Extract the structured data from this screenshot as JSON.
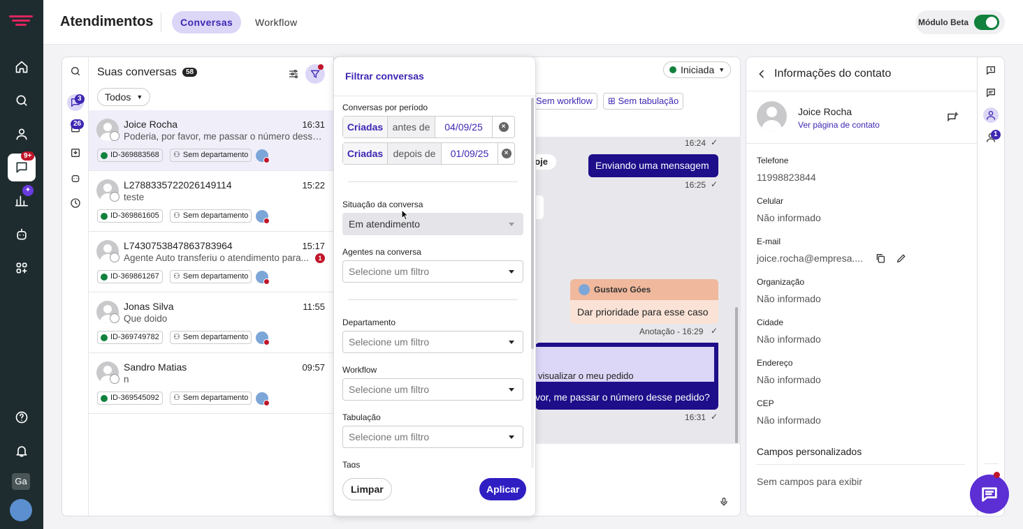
{
  "topbar": {
    "title": "Atendimentos",
    "tabs": [
      "Conversas",
      "Workflow"
    ],
    "beta_label": "Módulo Beta"
  },
  "rail": {
    "chat_badge": "9+",
    "user_initials": "Ga"
  },
  "conversations": {
    "title": "Suas conversas",
    "count": "58",
    "filter_value": "Todos",
    "rail_badges": [
      "3",
      "26"
    ],
    "items": [
      {
        "name": "Joice Rocha",
        "time": "16:31",
        "message": "Poderia, por favor, me passar o número desse pedido?",
        "id": "ID-369883568",
        "department": "Sem departamento",
        "unread": ""
      },
      {
        "name": "L2788335722026149114",
        "time": "15:22",
        "message": "teste",
        "id": "ID-369861605",
        "department": "Sem departamento",
        "unread": ""
      },
      {
        "name": "L7430753847863783964",
        "time": "15:17",
        "message": "Agente Auto transferiu o atendimento para...",
        "id": "ID-369861267",
        "department": "Sem departamento",
        "unread": "1"
      },
      {
        "name": "Jonas Silva",
        "time": "11:55",
        "message": "Que doido",
        "id": "ID-369749782",
        "department": "Sem departamento",
        "unread": ""
      },
      {
        "name": "Sandro Matias",
        "time": "09:57",
        "message": "n",
        "id": "ID-369545092",
        "department": "Sem departamento",
        "unread": ""
      }
    ]
  },
  "chat": {
    "status": "Iniciada",
    "chips": [
      "Sem workflow",
      "Sem tabulação"
    ],
    "day_label": "oje",
    "messages": [
      {
        "time": "16:24"
      },
      {
        "text": "Enviando uma mensagem",
        "time": "16:25"
      },
      {
        "note_author": "Gustavo Góes",
        "text": "Dar prioridade para esse caso",
        "time": "Anotação - 16:29"
      },
      {
        "quote": "visualizar o meu pedido",
        "text": "vor, me passar o número desse pedido?",
        "time": "16:31"
      }
    ]
  },
  "filter": {
    "title": "Filtrar conversas",
    "period_label": "Conversas por período",
    "period_rows": [
      {
        "field": "Criadas",
        "op": "antes de",
        "date": "04/09/25"
      },
      {
        "field": "Criadas",
        "op": "depois de",
        "date": "01/09/25"
      }
    ],
    "status_label": "Situação da conversa",
    "status_value": "Em atendimento",
    "agents_label": "Agentes na conversa",
    "department_label": "Departamento",
    "workflow_label": "Workflow",
    "tabulation_label": "Tabulação",
    "tags_label": "Tags",
    "placeholder": "Selecione um filtro",
    "clear_label": "Limpar",
    "apply_label": "Aplicar"
  },
  "contact": {
    "title": "Informações do contato",
    "name": "Joice Rocha",
    "link": "Ver página de contato",
    "fields": [
      {
        "label": "Telefone",
        "value": "11998823844"
      },
      {
        "label": "Celular",
        "value": "Não informado"
      },
      {
        "label": "E-mail",
        "value": "joice.rocha@empresa...."
      },
      {
        "label": "Organização",
        "value": "Não informado"
      },
      {
        "label": "Cidade",
        "value": "Não informado"
      },
      {
        "label": "Endereço",
        "value": "Não informado"
      },
      {
        "label": "CEP",
        "value": "Não informado"
      }
    ],
    "custom_title": "Campos personalizados",
    "custom_empty": "Sem campos para exibir",
    "side_badge": "1"
  },
  "colors": {
    "accent": "#3d27b3",
    "rail": "#1e2c2f",
    "online": "#11813d",
    "alert": "#c0152a"
  }
}
